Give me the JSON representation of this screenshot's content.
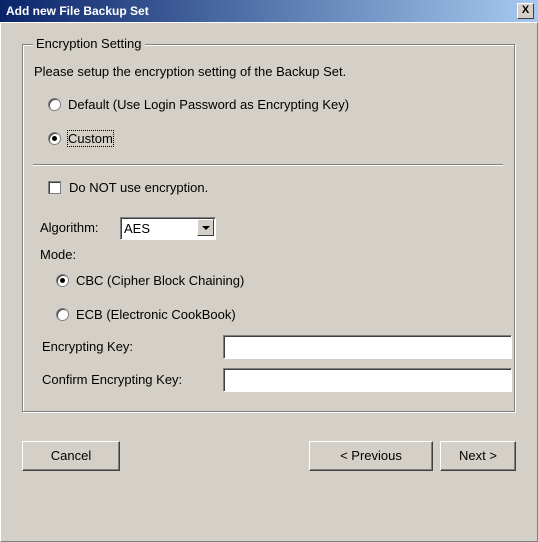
{
  "window": {
    "title": "Add new File Backup Set",
    "close_label": "X"
  },
  "encryption": {
    "group_label": "Encryption Setting",
    "description": "Please setup the encryption setting of the Backup Set.",
    "key_options": [
      {
        "label": "Default (Use Login Password as Encrypting Key)",
        "selected": false
      },
      {
        "label": "Custom",
        "selected": true
      }
    ],
    "no_encryption_label": "Do NOT use encryption.",
    "no_encryption_checked": false,
    "algorithm_label": "Algorithm:",
    "algorithm_value": "AES",
    "mode_label": "Mode:",
    "mode_options": [
      {
        "label": "CBC (Cipher Block Chaining)",
        "selected": true
      },
      {
        "label": "ECB (Electronic CookBook)",
        "selected": false
      }
    ],
    "key_label": "Encrypting Key:",
    "key_value": "",
    "confirm_key_label": "Confirm Encrypting Key:",
    "confirm_key_value": ""
  },
  "buttons": {
    "cancel": "Cancel",
    "previous": "< Previous",
    "next": "Next >"
  }
}
